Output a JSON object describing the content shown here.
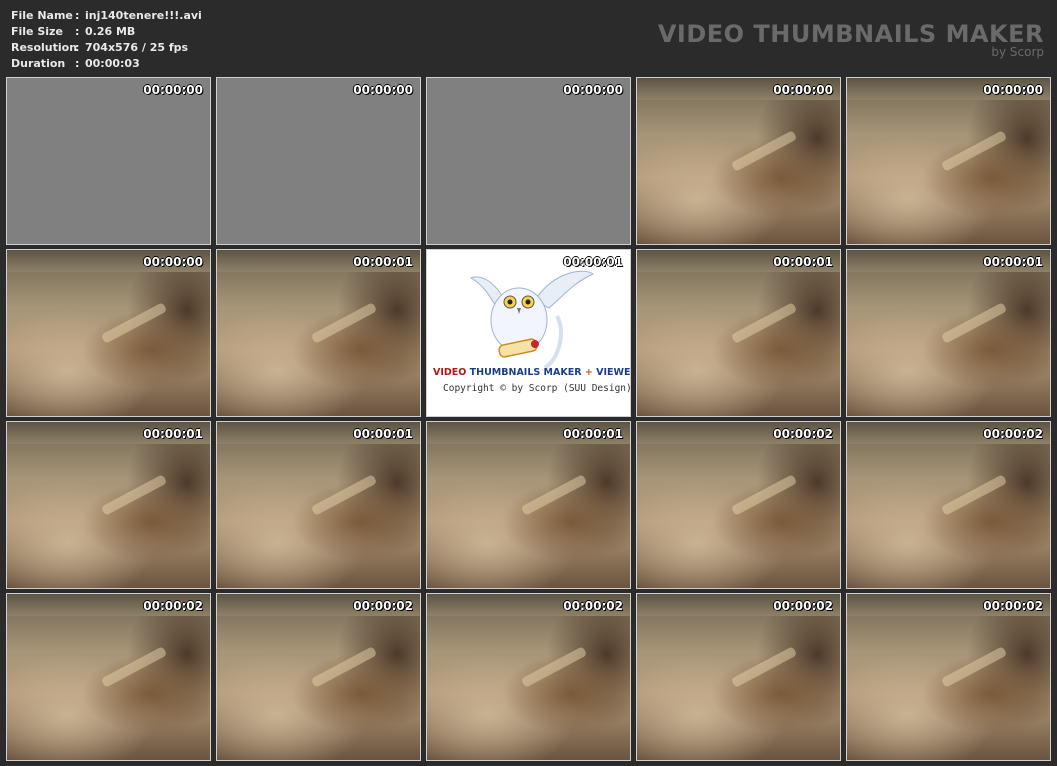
{
  "info": {
    "rows": [
      {
        "label": "File Name",
        "colon": ":",
        "value": "inj140tenere!!!.avi"
      },
      {
        "label": "File Size",
        "colon": ":",
        "value": "0.26 MB"
      },
      {
        "label": "Resolution",
        "colon": ":",
        "value": "704x576 / 25 fps"
      },
      {
        "label": "Duration",
        "colon": ":",
        "value": "00:00:03"
      }
    ]
  },
  "brand": {
    "title": "VIDEO THUMBNAILS MAKER",
    "subtitle": "by Scorp"
  },
  "logo": {
    "word1": "VIDEO",
    "word2": "THUMBNAILS MAKER",
    "plus": "+",
    "word3": "VIEWER",
    "copyright": "Copyright © by Scorp (SUU Design)"
  },
  "thumbnails": [
    {
      "time": "00:00:00",
      "kind": "blank"
    },
    {
      "time": "00:00:00",
      "kind": "blank"
    },
    {
      "time": "00:00:00",
      "kind": "blank"
    },
    {
      "time": "00:00:00",
      "kind": "frame"
    },
    {
      "time": "00:00:00",
      "kind": "frame"
    },
    {
      "time": "00:00:00",
      "kind": "frame"
    },
    {
      "time": "00:00:01",
      "kind": "frame"
    },
    {
      "time": "00:00:01",
      "kind": "logo"
    },
    {
      "time": "00:00:01",
      "kind": "frame"
    },
    {
      "time": "00:00:01",
      "kind": "frame"
    },
    {
      "time": "00:00:01",
      "kind": "frame"
    },
    {
      "time": "00:00:01",
      "kind": "frame"
    },
    {
      "time": "00:00:01",
      "kind": "frame"
    },
    {
      "time": "00:00:02",
      "kind": "frame"
    },
    {
      "time": "00:00:02",
      "kind": "frame"
    },
    {
      "time": "00:00:02",
      "kind": "frame"
    },
    {
      "time": "00:00:02",
      "kind": "frame"
    },
    {
      "time": "00:00:02",
      "kind": "frame"
    },
    {
      "time": "00:00:02",
      "kind": "frame"
    },
    {
      "time": "00:00:02",
      "kind": "frame"
    }
  ]
}
